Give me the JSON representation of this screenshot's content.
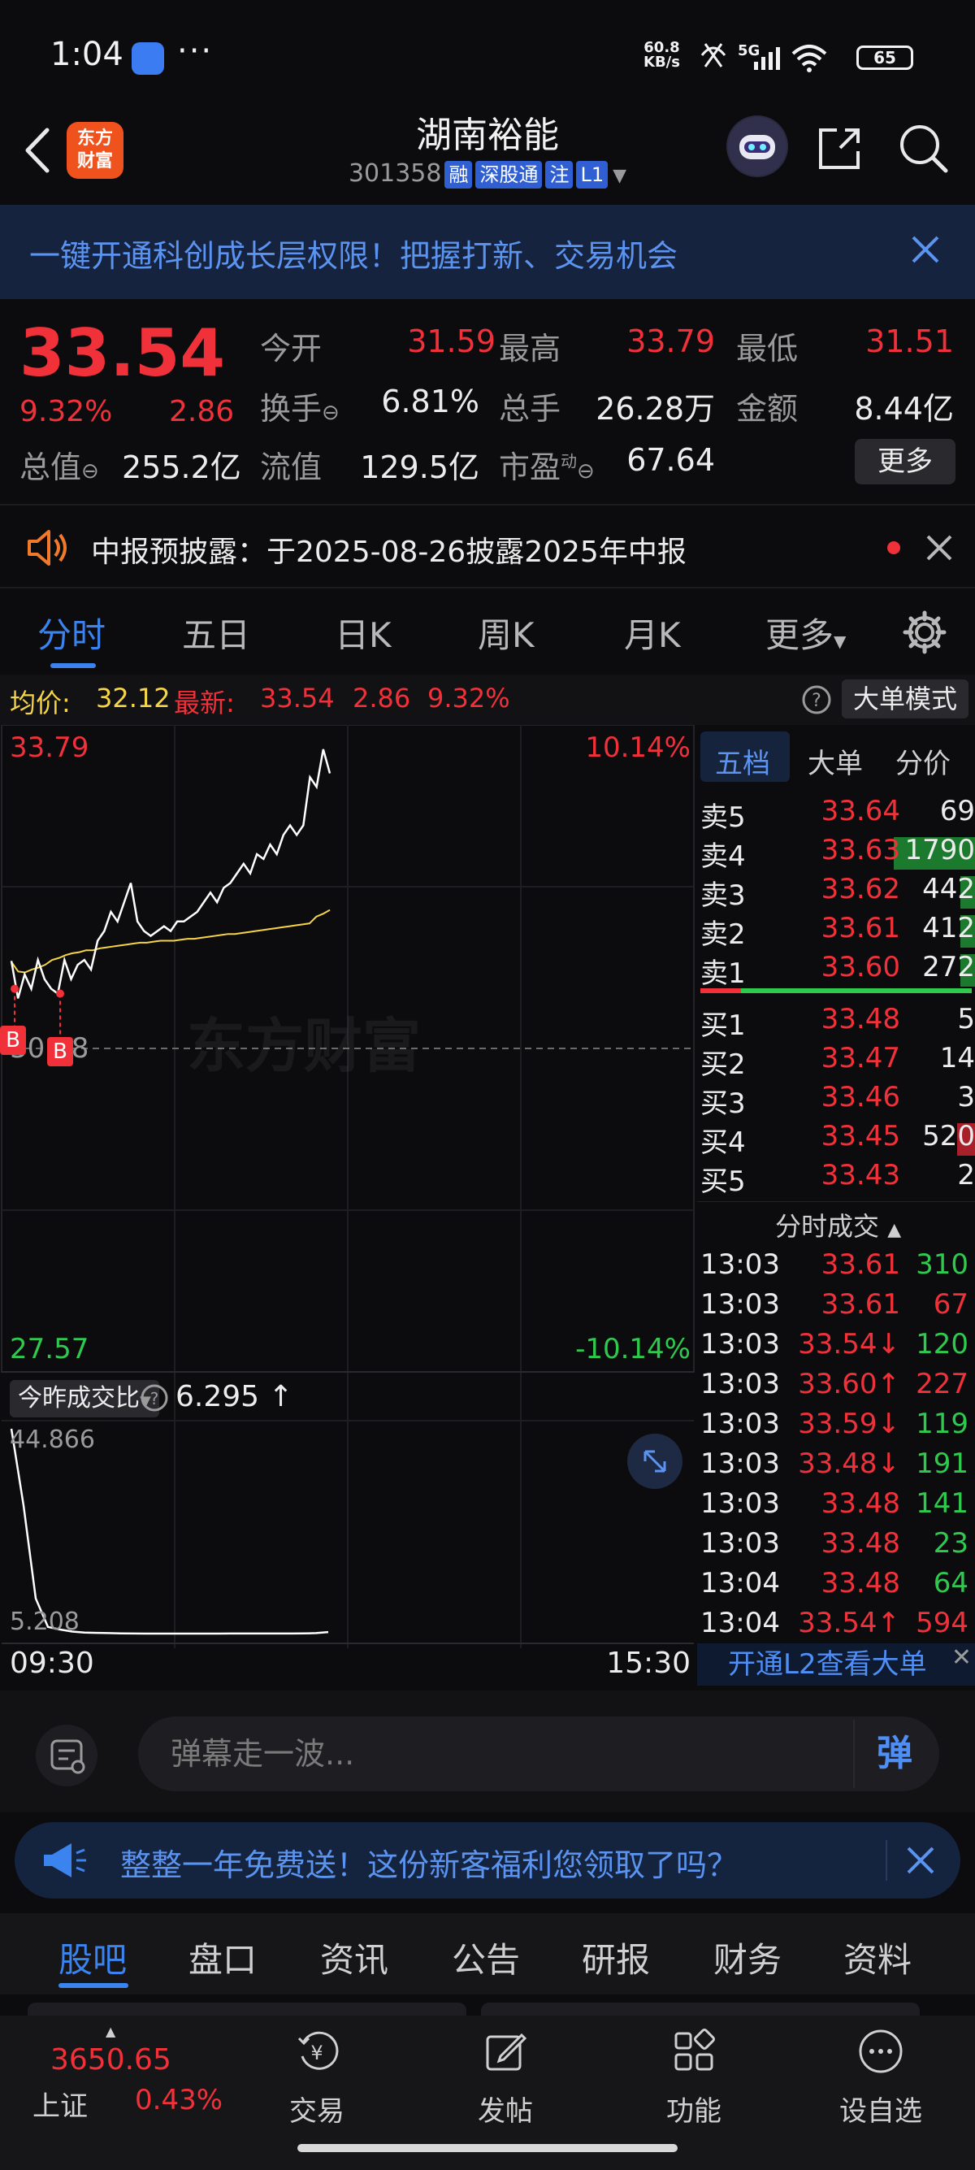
{
  "status": {
    "time": "1:04",
    "more": "···",
    "net_top": "60.8",
    "net_bottom": "KB/s",
    "signal": "5G",
    "battery": "65"
  },
  "header": {
    "stock_name": "湖南裕能",
    "code": "301358",
    "tags": [
      "融",
      "深股通",
      "注",
      "L1"
    ],
    "logo_line1": "东方",
    "logo_line2": "财富"
  },
  "banner": {
    "text": "一键开通科创成长层权限！把握打新、交易机会"
  },
  "quote": {
    "price": "33.54",
    "pct": "9.32%",
    "change": "2.86",
    "mktcap_label": "总值",
    "mktcap_value": "255.2亿",
    "fields": [
      {
        "label": "今开",
        "value": "31.59",
        "color": "red"
      },
      {
        "label": "最高",
        "value": "33.79",
        "color": "red"
      },
      {
        "label": "最低",
        "value": "31.51",
        "color": "red"
      },
      {
        "label": "换手",
        "value": "6.81%",
        "color": "white"
      },
      {
        "label": "总手",
        "value": "26.28万",
        "color": "white"
      },
      {
        "label": "金额",
        "value": "8.44亿",
        "color": "white"
      },
      {
        "label": "流值",
        "value": "129.5亿",
        "color": "white"
      },
      {
        "label": "市盈",
        "value": "67.64",
        "color": "white"
      }
    ],
    "pe_superscript": "动",
    "more_button": "更多"
  },
  "notice": {
    "text": "中报预披露：于2025-08-26披露2025年中报"
  },
  "chart_tabs": [
    "分时",
    "五日",
    "日K",
    "周K",
    "月K",
    "更多"
  ],
  "info_row": {
    "avg_label": "均价:",
    "avg_value": "32.12",
    "last_label": "最新:",
    "last_value": "33.54",
    "change": "2.86",
    "pct": "9.32%",
    "big_order_button": "大单模式"
  },
  "chart": {
    "high_price": "33.79",
    "high_pct": "10.14%",
    "low_price": "27.57",
    "low_pct": "-10.14%",
    "mid_label": "30.68",
    "watermark": "东方财富",
    "marker": "B",
    "volume_selector": "今昨成交比",
    "volume_ratio": "6.295",
    "volume_arrow": "↑",
    "vol_max": "44.866",
    "vol_min": "5.208",
    "time_start": "09:30",
    "time_end": "15:30"
  },
  "chart_data": {
    "type": "line",
    "title": "",
    "y_range": [
      27.57,
      33.79
    ],
    "series": [
      {
        "values": [
          31.59,
          31.2,
          31.45,
          31.3,
          31.6,
          31.4,
          31.3,
          31.25,
          31.6,
          31.4,
          31.55,
          31.6,
          31.5,
          31.8,
          31.9,
          32.1,
          32.0,
          32.2,
          32.4,
          32.0,
          31.9,
          31.85,
          31.9,
          31.95,
          31.9,
          32.0,
          32.0,
          32.05,
          32.1,
          32.2,
          32.3,
          32.2,
          32.35,
          32.4,
          32.5,
          32.6,
          32.5,
          32.7,
          32.65,
          32.8,
          32.7,
          32.9,
          33.0,
          32.9,
          33.0,
          33.5,
          33.4,
          33.79,
          33.54
        ]
      },
      {
        "values": [
          31.58,
          31.48,
          31.47,
          31.5,
          31.52,
          31.55,
          31.6,
          31.62,
          31.65,
          31.67,
          31.68,
          31.7,
          31.7,
          31.72,
          31.73,
          31.74,
          31.75,
          31.76,
          31.77,
          31.78,
          31.78,
          31.79,
          31.8,
          31.8,
          31.8,
          31.81,
          31.82,
          31.82,
          31.83,
          31.84,
          31.85,
          31.86,
          31.87,
          31.87,
          31.88,
          31.89,
          31.9,
          31.91,
          31.92,
          31.93,
          31.94,
          31.95,
          31.96,
          31.97,
          31.98,
          32.05,
          32.08,
          32.12
        ]
      }
    ],
    "volume_ratio_series": [
      44.866,
      30,
      12,
      6.5,
      6.0,
      5.6,
      5.4,
      5.35,
      5.3,
      5.25,
      5.22,
      5.21,
      5.208,
      5.21,
      5.21,
      5.21,
      5.21,
      5.21,
      5.22,
      5.22,
      5.22,
      5.23,
      5.23,
      5.23,
      5.25,
      5.3,
      5.5
    ]
  },
  "order_book": {
    "tabs": [
      "五档",
      "大单",
      "分价"
    ],
    "asks": [
      {
        "label": "卖5",
        "price": "33.64",
        "vol": "69"
      },
      {
        "label": "卖4",
        "price": "33.63",
        "vol": "1790"
      },
      {
        "label": "卖3",
        "price": "33.62",
        "vol": "442"
      },
      {
        "label": "卖2",
        "price": "33.61",
        "vol": "412"
      },
      {
        "label": "卖1",
        "price": "33.60",
        "vol": "272"
      }
    ],
    "bids": [
      {
        "label": "买1",
        "price": "33.48",
        "vol": "5"
      },
      {
        "label": "买2",
        "price": "33.47",
        "vol": "14"
      },
      {
        "label": "买3",
        "price": "33.46",
        "vol": "3"
      },
      {
        "label": "买4",
        "price": "33.45",
        "vol": "520"
      },
      {
        "label": "买5",
        "price": "33.43",
        "vol": "2"
      }
    ],
    "trades_header": "分时成交",
    "trades": [
      {
        "time": "13:03",
        "price": "33.61",
        "vol": "310",
        "pcolor": "red",
        "vcolor": "green"
      },
      {
        "time": "13:03",
        "price": "33.61",
        "vol": "67",
        "pcolor": "red",
        "vcolor": "red"
      },
      {
        "time": "13:03",
        "price": "33.54↓",
        "vol": "120",
        "pcolor": "red",
        "vcolor": "green"
      },
      {
        "time": "13:03",
        "price": "33.60↑",
        "vol": "227",
        "pcolor": "red",
        "vcolor": "red"
      },
      {
        "time": "13:03",
        "price": "33.59↓",
        "vol": "119",
        "pcolor": "red",
        "vcolor": "green"
      },
      {
        "time": "13:03",
        "price": "33.48↓",
        "vol": "191",
        "pcolor": "red",
        "vcolor": "green"
      },
      {
        "time": "13:03",
        "price": "33.48",
        "vol": "141",
        "pcolor": "red",
        "vcolor": "green"
      },
      {
        "time": "13:03",
        "price": "33.48",
        "vol": "23",
        "pcolor": "red",
        "vcolor": "green"
      },
      {
        "time": "13:04",
        "price": "33.48",
        "vol": "64",
        "pcolor": "red",
        "vcolor": "green"
      },
      {
        "time": "13:04",
        "price": "33.54↑",
        "vol": "594",
        "pcolor": "red",
        "vcolor": "red"
      }
    ],
    "l2_link": "开通L2查看大单"
  },
  "comment": {
    "placeholder": "弹幕走一波...",
    "danmaku_button": "弹"
  },
  "promo": {
    "text": "整整一年免费送！这份新客福利您领取了吗？"
  },
  "bottom_tabs": [
    "股吧",
    "盘口",
    "资讯",
    "公告",
    "研报",
    "财务",
    "资料"
  ],
  "nav": {
    "index_value": "3650.65",
    "index_name": "上证",
    "index_pct": "0.43%",
    "items": [
      "交易",
      "发帖",
      "功能",
      "设自选"
    ]
  },
  "colors": {
    "red": "#f0313a",
    "green": "#2fc94e",
    "blue": "#3b84f0",
    "yellow": "#f5d547"
  }
}
